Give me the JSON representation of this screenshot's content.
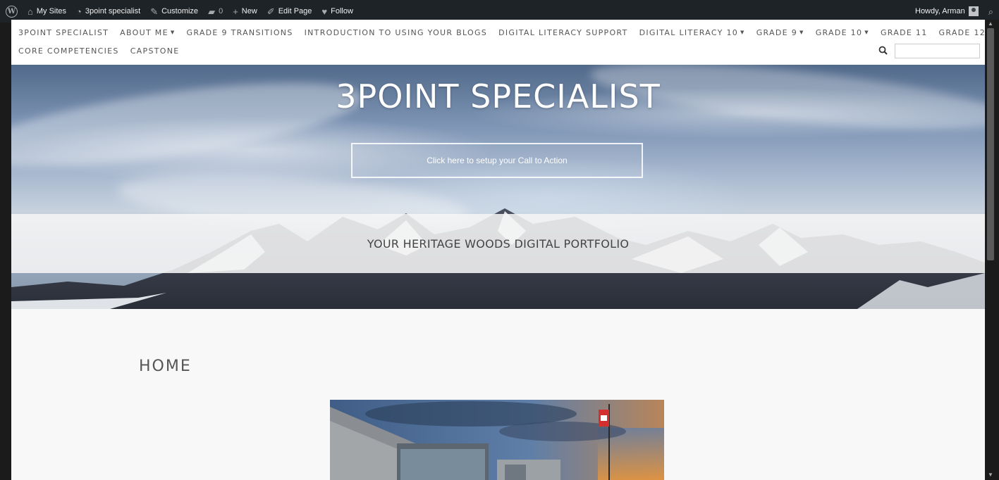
{
  "adminbar": {
    "my_sites": "My Sites",
    "site_name": "3point specialist",
    "customize": "Customize",
    "comments_count": "0",
    "new": "New",
    "edit_page": "Edit Page",
    "follow": "Follow",
    "howdy": "Howdy, Arman"
  },
  "nav": {
    "row1": [
      {
        "label": "3POINT SPECIALIST",
        "dropdown": false
      },
      {
        "label": "ABOUT ME",
        "dropdown": true
      },
      {
        "label": "GRADE 9 TRANSITIONS",
        "dropdown": false
      },
      {
        "label": "INTRODUCTION TO USING YOUR BLOGS",
        "dropdown": false
      },
      {
        "label": "DIGITAL LITERACY SUPPORT",
        "dropdown": false
      },
      {
        "label": "DIGITAL LITERACY 10",
        "dropdown": true
      },
      {
        "label": "GRADE 9",
        "dropdown": true
      },
      {
        "label": "GRADE 10",
        "dropdown": true
      },
      {
        "label": "GRADE 11",
        "dropdown": false
      },
      {
        "label": "GRADE 12",
        "dropdown": false
      }
    ],
    "row2": [
      {
        "label": "CORE COMPETENCIES",
        "dropdown": false
      },
      {
        "label": "CAPSTONE",
        "dropdown": false
      }
    ],
    "search_value": ""
  },
  "hero": {
    "title": "3POINT SPECIALIST",
    "cta": "Click here to setup your Call to Action",
    "tagline": "YOUR HERITAGE WOODS DIGITAL PORTFOLIO"
  },
  "content": {
    "page_title": "HOME"
  },
  "colors": {
    "adminbar_bg": "#1d2327",
    "page_bg": "#f8f8f8",
    "nav_text": "#555555"
  }
}
